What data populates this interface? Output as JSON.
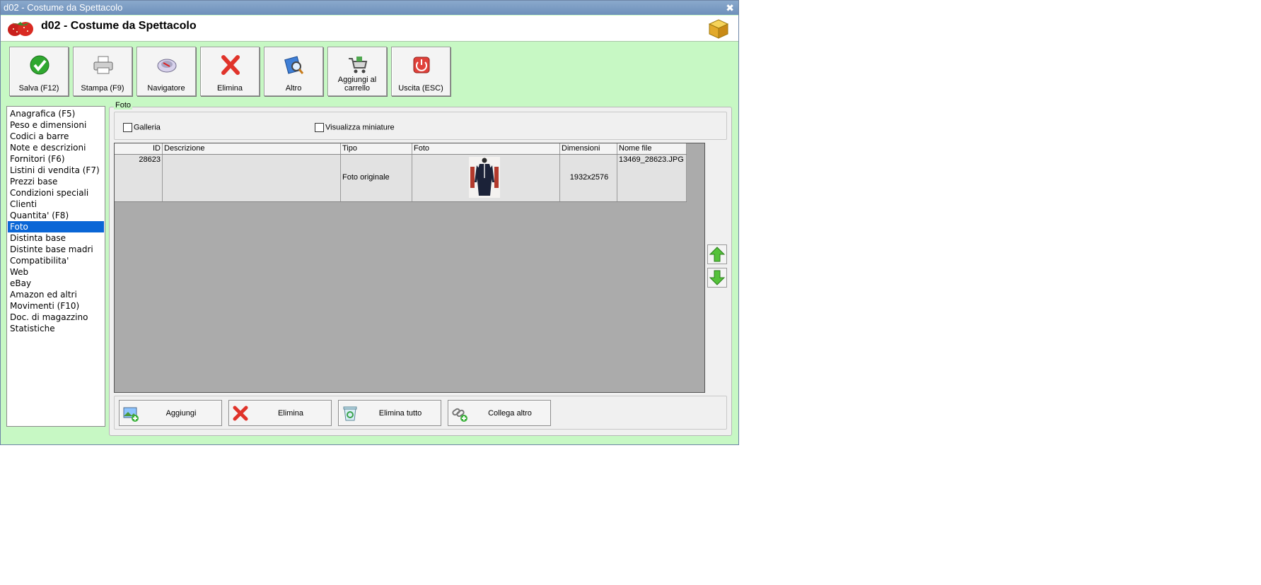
{
  "window": {
    "title": "d02 - Costume da Spettacolo",
    "header_title": "d02 - Costume da Spettacolo",
    "close_glyph": "✖"
  },
  "toolbar": {
    "buttons": [
      {
        "label": "Salva (F12)",
        "icon": "check-icon"
      },
      {
        "label": "Stampa (F9)",
        "icon": "printer-icon"
      },
      {
        "label": "Navigatore",
        "icon": "navigator-icon"
      },
      {
        "label": "Elimina",
        "icon": "delete-x-icon"
      },
      {
        "label": "Altro",
        "icon": "search-doc-icon"
      },
      {
        "label": "Aggiungi al carrello",
        "icon": "cart-icon"
      },
      {
        "label": "Uscita (ESC)",
        "icon": "exit-power-icon"
      }
    ]
  },
  "sidebar": {
    "selected": "Foto",
    "items": [
      "Anagrafica (F5)",
      "Peso e dimensioni",
      "Codici a barre",
      "Note e descrizioni",
      "Fornitori (F6)",
      "Listini di vendita (F7)",
      "Prezzi base",
      "Condizioni speciali",
      "Clienti",
      "Quantita' (F8)",
      "Foto",
      "Distinta base",
      "Distinte base madri",
      "Compatibilita'",
      "Web",
      "eBay",
      "Amazon ed altri",
      "Movimenti (F10)",
      "Doc. di magazzino",
      "Statistiche"
    ]
  },
  "foto": {
    "group_label": "Foto",
    "galleria_label": "Galleria",
    "galleria_checked": false,
    "miniature_label": "Visualizza miniature",
    "miniature_checked": false,
    "columns": [
      "ID",
      "Descrizione",
      "Tipo",
      "Foto",
      "Dimensioni",
      "Nome file"
    ],
    "rows": [
      {
        "id": "28623",
        "descrizione": "",
        "tipo": "Foto originale",
        "dimensioni": "1932x2576",
        "nome_file": "13469_28623.JPG"
      }
    ]
  },
  "actions": {
    "aggiungi": "Aggiungi",
    "elimina": "Elimina",
    "elimina_tutto": "Elimina tutto",
    "collega_altro": "Collega altro"
  },
  "colors": {
    "window_bg": "#c7f8c4",
    "selection": "#0a66d6",
    "title_bar": "#7a99c2",
    "grid_bg": "#ababab"
  }
}
